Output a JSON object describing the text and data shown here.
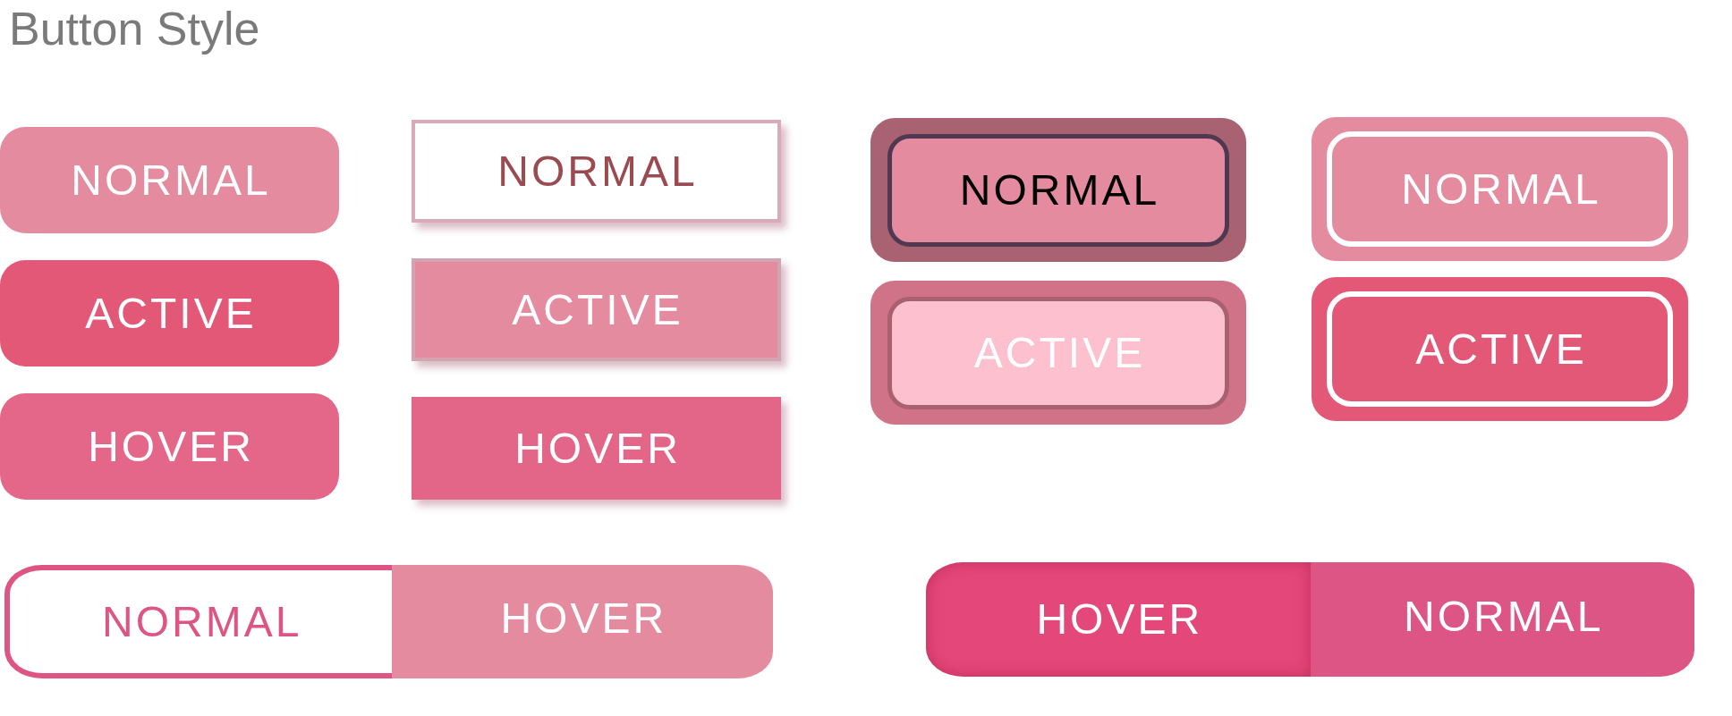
{
  "title": "Button Style",
  "button_columns": [
    {
      "kind": "rounded",
      "buttons": [
        {
          "label": "NORMAL",
          "kind": "normal"
        },
        {
          "label": "ACTIVE",
          "kind": "active"
        },
        {
          "label": "HOVER",
          "kind": "hover"
        }
      ]
    },
    {
      "kind": "outlined",
      "buttons": [
        {
          "label": "NORMAL",
          "kind": "normal"
        },
        {
          "label": "ACTIVE",
          "kind": "active"
        },
        {
          "label": "HOVER",
          "kind": "hover"
        }
      ]
    },
    {
      "kind": "framed-dark",
      "buttons": [
        {
          "label": "NORMAL",
          "kind": "normal"
        },
        {
          "label": "ACTIVE",
          "kind": "active"
        }
      ]
    },
    {
      "kind": "framed-light",
      "buttons": [
        {
          "label": "NORMAL",
          "kind": "normal"
        },
        {
          "label": "ACTIVE",
          "kind": "active"
        }
      ]
    }
  ],
  "segmented_groups": [
    {
      "kind": "outline",
      "segments": [
        {
          "label": "NORMAL",
          "kind": "normal"
        },
        {
          "label": "HOVER",
          "kind": "hover"
        }
      ]
    },
    {
      "kind": "filled",
      "segments": [
        {
          "label": "HOVER",
          "kind": "hover"
        },
        {
          "label": "NORMAL",
          "kind": "normal"
        }
      ]
    }
  ]
}
